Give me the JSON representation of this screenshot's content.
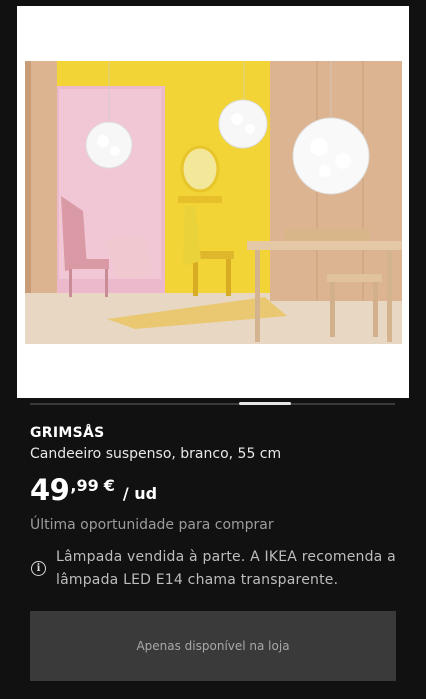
{
  "product": {
    "name": "GRIMSÅS",
    "description": "Candeeiro suspenso, branco, 55 cm",
    "price_integer": "49",
    "price_decimal": ",99",
    "price_currency": "€",
    "price_unit": "/ ud",
    "availability": "Última oportunidade para comprar",
    "info_line1": "Lâmpada vendida à parte. A IKEA recomenda a",
    "info_line2": "lâmpada LED E14 chama transparente.",
    "info_icon": "info-circle-icon"
  },
  "action": {
    "button_label": "Apenas disponível na loja"
  },
  "carousel": {
    "active_index": 2
  },
  "colors": {
    "background": "#111111",
    "button_bg": "#3a3a3a",
    "muted_text": "#9c9c9c"
  }
}
